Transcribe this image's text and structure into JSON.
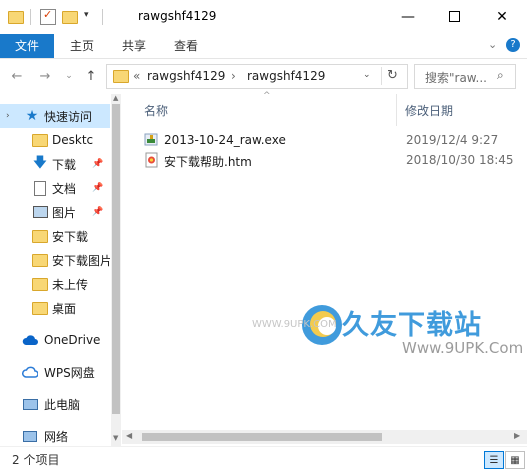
{
  "window": {
    "title": "rawgshf4129"
  },
  "ribbon": {
    "tabs": [
      "文件",
      "主页",
      "共享",
      "查看"
    ]
  },
  "address": {
    "overflow": "«",
    "segments": [
      "rawgshf4129",
      "rawgshf4129"
    ]
  },
  "search": {
    "placeholder": "搜索\"raw..."
  },
  "sidebar": {
    "items": [
      {
        "label": "快速访问"
      },
      {
        "label": "Desktc"
      },
      {
        "label": "下载"
      },
      {
        "label": "文档"
      },
      {
        "label": "图片"
      },
      {
        "label": "安下载"
      },
      {
        "label": "安下载图片"
      },
      {
        "label": "未上传"
      },
      {
        "label": "桌面"
      },
      {
        "label": "OneDrive"
      },
      {
        "label": "WPS网盘"
      },
      {
        "label": "此电脑"
      },
      {
        "label": "网络"
      }
    ]
  },
  "columns": {
    "name": "名称",
    "modified": "修改日期"
  },
  "files": [
    {
      "name": "2013-10-24_raw.exe",
      "date": "2019/12/4 9:27",
      "icon": "exe-installer-icon"
    },
    {
      "name": "安下载帮助.htm",
      "date": "2018/10/30 18:45",
      "icon": "htm-file-icon"
    }
  ],
  "watermark": {
    "title": "久友下载站",
    "url": "Www.9UPK.Com",
    "left": "WWW.9UPK.COM"
  },
  "status": {
    "count": "2 个项目"
  },
  "colors": {
    "accent": "#1979ca",
    "selection": "#cce8ff",
    "folder": "#f8d775"
  }
}
